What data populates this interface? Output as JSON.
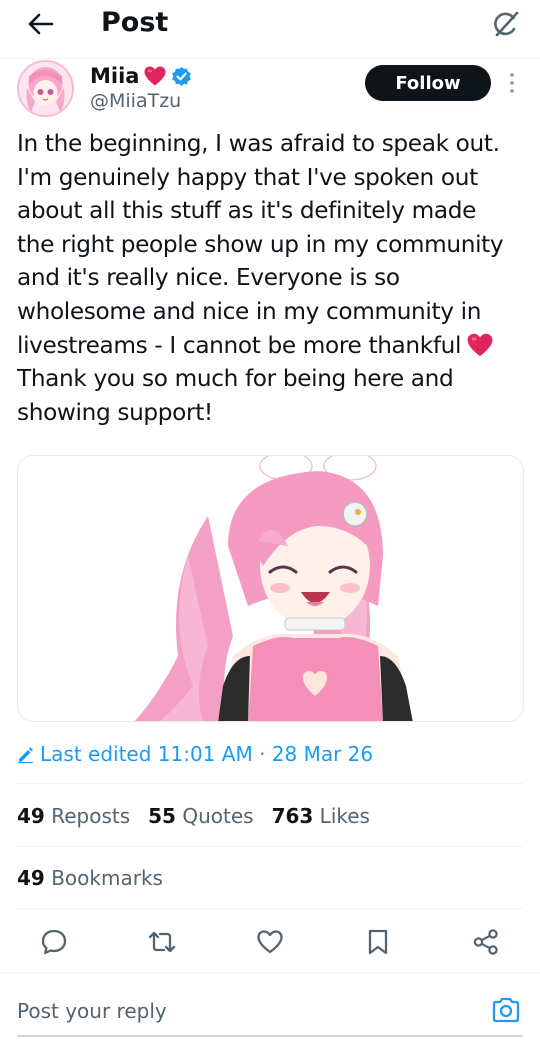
{
  "header": {
    "title": "Post",
    "back_icon": "arrow-left-icon",
    "grok_icon": "grok-icon"
  },
  "author": {
    "display_name": "Miia",
    "name_emoji": "red-heart-icon",
    "verified_icon": "verified-badge-icon",
    "verified_color": "#1d9bf0",
    "handle": "@MiiaTzu"
  },
  "follow_label": "Follow",
  "post": {
    "lines": [
      "In the beginning, I was afraid to speak out.",
      "I'm genuinely happy that I've spoken out",
      "about all this stuff as it's definitely made",
      "the right people show up in my community",
      "and it's really nice. Everyone is so",
      "wholesome and nice in my community in",
      "livestreams - I cannot be more thankful",
      "Thank you so much for being here and",
      "showing support!"
    ],
    "inline_emoji": "red-heart-icon"
  },
  "edited": {
    "label": "Last edited 11:01 AM · 28 Mar 26",
    "icon": "pencil-icon",
    "color": "#1d9bf0"
  },
  "stats": {
    "reposts_count": "49",
    "reposts_label": "Reposts",
    "quotes_count": "55",
    "quotes_label": "Quotes",
    "likes_count": "763",
    "likes_label": "Likes",
    "bookmarks_count": "49",
    "bookmarks_label": "Bookmarks"
  },
  "actions": [
    "reply-icon",
    "repost-icon",
    "like-icon",
    "bookmark-icon",
    "share-icon"
  ],
  "reply": {
    "placeholder": "Post your reply",
    "camera_icon": "camera-icon"
  },
  "colors": {
    "accent": "#1d9bf0",
    "heart": "#e0245e",
    "text": "#0f1419",
    "secondary_text": "#536471"
  }
}
